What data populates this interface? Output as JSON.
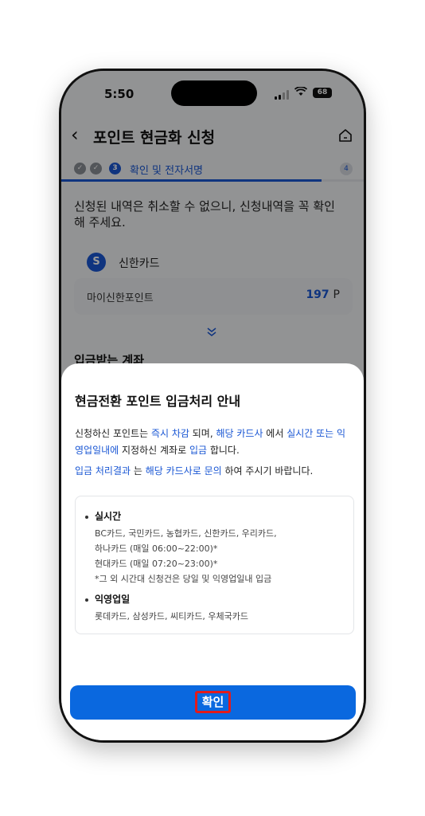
{
  "status_bar": {
    "time": "5:50",
    "battery": "68"
  },
  "header": {
    "title": "포인트 현금화 신청"
  },
  "steps": {
    "current_number": "3",
    "current_label": "확인 및 전자서명",
    "total": "4",
    "progress": 0.86
  },
  "notice": "신청된 내역은 취소할 수 없으니, 신청내역을 꼭 확인해 주세요.",
  "card": {
    "name": "신한카드",
    "point_label": "마이신한포인트",
    "point_value": "197",
    "point_unit": "P"
  },
  "section_label": "입금받는 계좌",
  "sheet": {
    "title": "현금전환 포인트 입금처리 안내",
    "para1": [
      {
        "t": "신청하신 포인트는 ",
        "hl": false
      },
      {
        "t": "즉시 차감",
        "hl": true
      },
      {
        "t": " 되며, ",
        "hl": false
      },
      {
        "t": "해당 카드사",
        "hl": true
      },
      {
        "t": " 에서 ",
        "hl": false
      },
      {
        "t": "실시간 또는 익영업일내에",
        "hl": true
      },
      {
        "t": " 지정하신 계좌로 ",
        "hl": false
      },
      {
        "t": "입금",
        "hl": true
      },
      {
        "t": " 합니다.",
        "hl": false
      }
    ],
    "para2": [
      {
        "t": "입금 처리결과",
        "hl": true
      },
      {
        "t": " 는 ",
        "hl": false
      },
      {
        "t": "해당 카드사로 문의",
        "hl": true
      },
      {
        "t": " 하여 주시기 바랍니다.",
        "hl": false
      }
    ],
    "realtime_title": "실시간",
    "realtime_lines": [
      "BC카드, 국민카드, 농협카드, 신한카드, 우리카드,",
      "하나카드 (매일 06:00~22:00)*",
      "현대카드 (매일 07:20~23:00)*",
      "*그 외 시간대 신청건은 당일 및 익영업일내 입금"
    ],
    "nextday_title": "익영업일",
    "nextday_lines": [
      "롯데카드, 삼성카드, 씨티카드, 우체국카드"
    ],
    "confirm_label": "확인"
  }
}
